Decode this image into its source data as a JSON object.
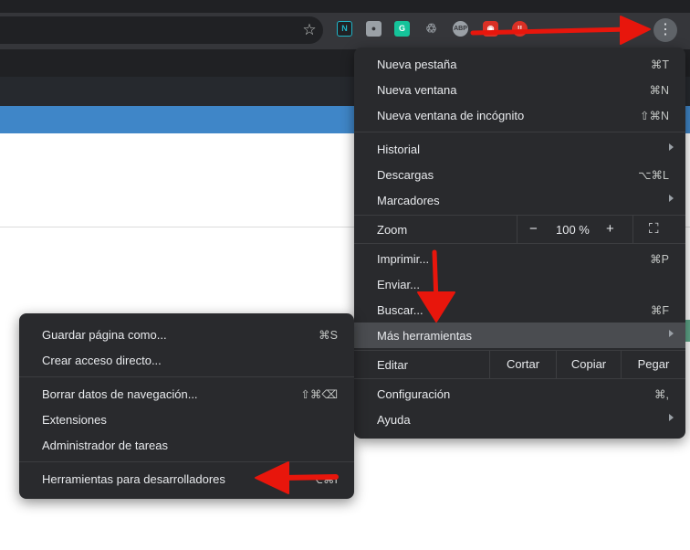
{
  "toolbar": {
    "extensions": [
      {
        "name": "notion-web-clipper-extension-icon",
        "glyph": "N",
        "color": "#1fb5c8"
      },
      {
        "name": "lightbulb-extension-icon",
        "glyph": "●",
        "color": "#9aa0a6"
      },
      {
        "name": "grammarly-extension-icon",
        "glyph": "G",
        "color": "#15c39a"
      },
      {
        "name": "recycle-extension-icon",
        "glyph": "♲",
        "color": "#5f6368"
      },
      {
        "name": "adblock-plus-extension-icon",
        "glyph": "ABP",
        "color": "#9aa0a6"
      },
      {
        "name": "red-extension-icon",
        "glyph": "◉",
        "color": "#d93025"
      },
      {
        "name": "red-badge-extension-icon",
        "glyph": "!!",
        "color": "#d93025"
      }
    ],
    "star_glyph": "☆",
    "kebab_glyph": "⋮"
  },
  "main_menu": {
    "nueva_pestana": {
      "label": "Nueva pestaña",
      "shortcut": "⌘T"
    },
    "nueva_ventana": {
      "label": "Nueva ventana",
      "shortcut": "⌘N"
    },
    "incognito": {
      "label": "Nueva ventana de incógnito",
      "shortcut": "⇧⌘N"
    },
    "historial": {
      "label": "Historial"
    },
    "descargas": {
      "label": "Descargas",
      "shortcut": "⌥⌘L"
    },
    "marcadores": {
      "label": "Marcadores"
    },
    "zoom": {
      "label": "Zoom",
      "minus": "−",
      "value": "100 %",
      "plus": "+",
      "fullscreen": "⛶"
    },
    "imprimir": {
      "label": "Imprimir...",
      "shortcut": "⌘P"
    },
    "enviar": {
      "label": "Enviar..."
    },
    "buscar": {
      "label": "Buscar...",
      "shortcut": "⌘F"
    },
    "mas_herramientas": {
      "label": "Más herramientas"
    },
    "editar": {
      "label": "Editar",
      "cortar": "Cortar",
      "copiar": "Copiar",
      "pegar": "Pegar"
    },
    "configuracion": {
      "label": "Configuración",
      "shortcut": "⌘,"
    },
    "ayuda": {
      "label": "Ayuda"
    }
  },
  "sub_menu": {
    "guardar": {
      "label": "Guardar página como...",
      "shortcut": "⌘S"
    },
    "acceso": {
      "label": "Crear acceso directo..."
    },
    "borrar": {
      "label": "Borrar datos de navegación...",
      "shortcut": "⇧⌘⌫"
    },
    "extensiones": {
      "label": "Extensiones"
    },
    "administrador": {
      "label": "Administrador de tareas"
    },
    "devtools": {
      "label": "Herramientas para desarrolladores",
      "shortcut": "⌥⌘I"
    }
  },
  "colors": {
    "annotation": "#e8160c",
    "menu_bg": "#292a2d",
    "highlight": "#4a4c50"
  }
}
